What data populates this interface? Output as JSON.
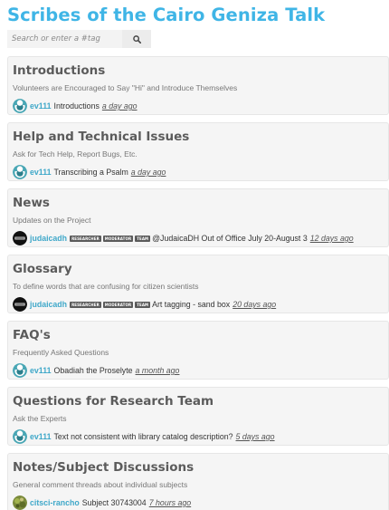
{
  "site": {
    "title": "Scribes of the Cairo Geniza Talk"
  },
  "search": {
    "placeholder": "Search or enter a #tag",
    "icon": "search-icon"
  },
  "colors": {
    "accent": "#3fb5e6",
    "board_bg": "#f5f5f5",
    "badge_bg": "#5b5b5b"
  },
  "boards": [
    {
      "title": "Introductions",
      "description": "Volunteers are Encouraged to Say \"Hi\" and Introduce Themselves",
      "latest": {
        "user": "ev111",
        "avatar": "zooniverse-avatar-icon",
        "badges": [],
        "discussion": "Introductions",
        "time": "a day ago"
      }
    },
    {
      "title": "Help and Technical Issues",
      "description": "Ask for Tech Help, Report Bugs, Etc.",
      "latest": {
        "user": "ev111",
        "avatar": "zooniverse-avatar-icon",
        "badges": [],
        "discussion": "Transcribing a Psalm",
        "time": "a day ago"
      }
    },
    {
      "title": "News",
      "description": "Updates on the Project",
      "latest": {
        "user": "judaicadh",
        "avatar": "judaicadh-avatar-icon",
        "badges": [
          "RESEARCHER",
          "MODERATOR",
          "TEAM"
        ],
        "discussion": "@JudaicaDH Out of Office July 20-August 3",
        "time": "12 days ago"
      }
    },
    {
      "title": "Glossary",
      "description": "To define words that are confusing for citizen scientists",
      "latest": {
        "user": "judaicadh",
        "avatar": "judaicadh-avatar-icon",
        "badges": [
          "RESEARCHER",
          "MODERATOR",
          "TEAM"
        ],
        "discussion": "Art tagging - sand box",
        "time": "20 days ago"
      }
    },
    {
      "title": "FAQ's",
      "description": "Frequently Asked Questions",
      "latest": {
        "user": "ev111",
        "avatar": "zooniverse-avatar-icon",
        "badges": [],
        "discussion": "Obadiah the Proselyte",
        "time": "a month ago"
      }
    },
    {
      "title": "Questions for Research Team",
      "description": "Ask the Experts",
      "latest": {
        "user": "ev111",
        "avatar": "zooniverse-avatar-icon",
        "badges": [],
        "discussion": "Text not consistent with library catalog description?",
        "time": "5 days ago"
      }
    },
    {
      "title": "Notes/Subject Discussions",
      "description": "General comment threads about individual subjects",
      "latest": {
        "user": "citsci-rancho",
        "avatar": "photo-avatar-icon",
        "badges": [],
        "discussion": "Subject 30743004",
        "time": "7 hours ago"
      }
    }
  ]
}
